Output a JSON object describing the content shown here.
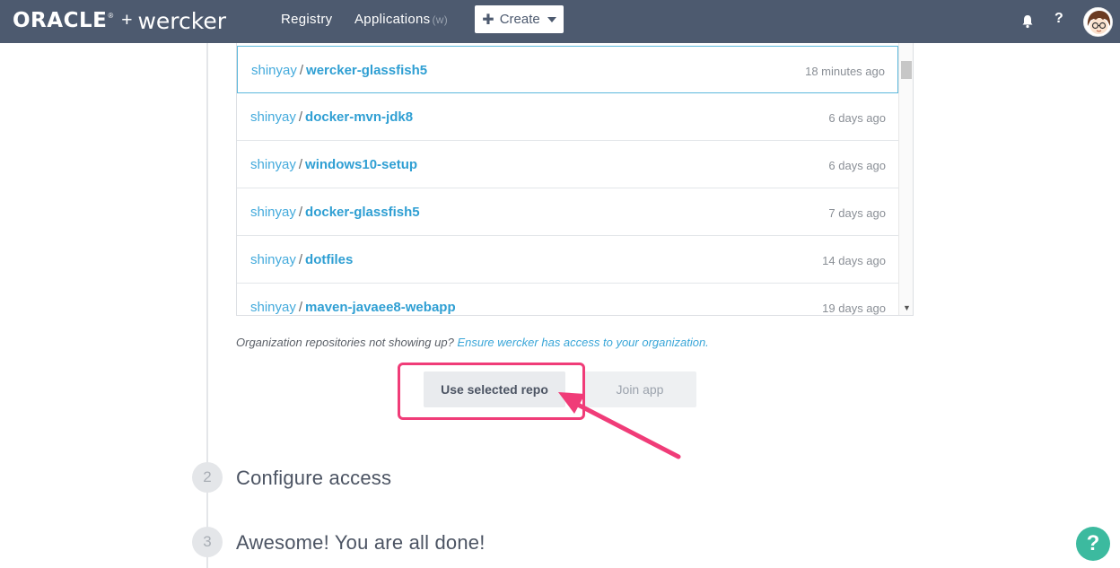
{
  "nav": {
    "brand_oracle": "ORACLE",
    "brand_reg": "®",
    "brand_plus": "+",
    "brand_wercker": "wercker",
    "registry": "Registry",
    "applications": "Applications",
    "applications_hint": "(w)",
    "create": "Create",
    "help": "?"
  },
  "repos": [
    {
      "owner": "shinyay",
      "name": "wercker-glassfish5",
      "time": "18 minutes ago",
      "selected": true
    },
    {
      "owner": "shinyay",
      "name": "docker-mvn-jdk8",
      "time": "6 days ago"
    },
    {
      "owner": "shinyay",
      "name": "windows10-setup",
      "time": "6 days ago"
    },
    {
      "owner": "shinyay",
      "name": "docker-glassfish5",
      "time": "7 days ago"
    },
    {
      "owner": "shinyay",
      "name": "dotfiles",
      "time": "14 days ago"
    },
    {
      "owner": "shinyay",
      "name": "maven-javaee8-webapp",
      "time": "19 days ago"
    }
  ],
  "org_hint": {
    "text": "Organization repositories not showing up?",
    "link": "Ensure wercker has access to your organization."
  },
  "buttons": {
    "use_selected": "Use selected repo",
    "join_app": "Join app"
  },
  "steps": [
    {
      "number": "2",
      "title": "Configure access"
    },
    {
      "number": "3",
      "title": "Awesome! You are all done!"
    }
  ],
  "floating_help": "?",
  "colors": {
    "topbar": "#4d5a6f",
    "link": "#2f9fd3",
    "highlight": "#f03c78",
    "help_bubble": "#3cba9f"
  }
}
